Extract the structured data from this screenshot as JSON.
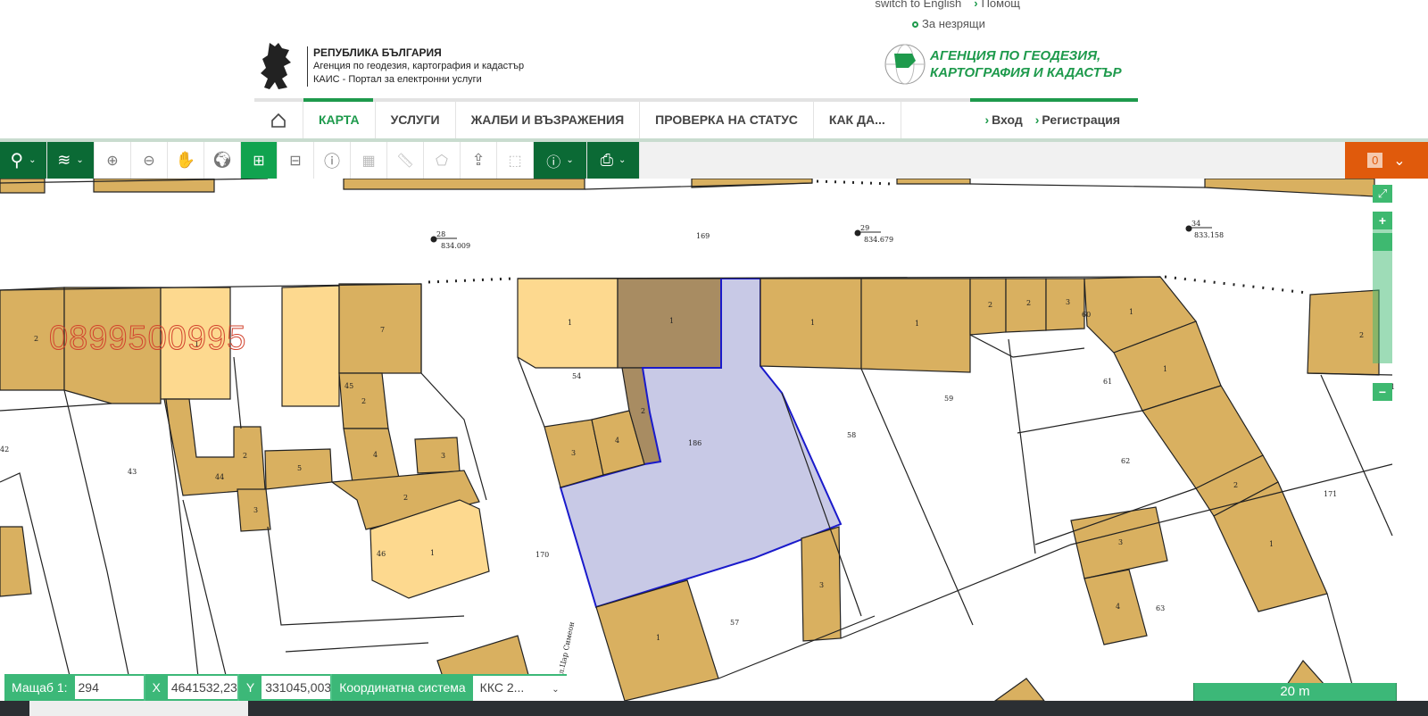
{
  "header": {
    "switch_language": "switch to English",
    "help": "Помощ",
    "blind": "За незрящи",
    "brand_line1": "РЕПУБЛИКА БЪЛГАРИЯ",
    "brand_line2": "Агенция по геодезия, картография и кадастър",
    "brand_line3": "КАИС - Портал за електронни услуги",
    "agency_line1": "АГЕНЦИЯ ПО ГЕОДЕЗИЯ,",
    "agency_line2": "КАРТОГРАФИЯ И КАДАСТЪР"
  },
  "nav": {
    "items": [
      {
        "label": "КАРТА",
        "active": true
      },
      {
        "label": "УСЛУГИ"
      },
      {
        "label": "ЖАЛБИ И ВЪЗРАЖЕНИЯ"
      },
      {
        "label": "ПРОВЕРКА НА СТАТУС"
      },
      {
        "label": "КАК ДА..."
      }
    ],
    "login": "Вход",
    "register": "Регистрация"
  },
  "toolbar": {
    "icons": [
      "search-icon",
      "layers-icon",
      "zoom-in-icon",
      "zoom-out-icon",
      "pan-hand-icon",
      "globe-icon",
      "select-add-icon",
      "select-remove-icon",
      "info-icon",
      "measure-area-icon",
      "ruler-icon",
      "polygon-icon",
      "upload-icon",
      "select-area-icon",
      "layer-info-icon",
      "print-icon"
    ],
    "active_tool": "select-add-icon",
    "cart_count": "0"
  },
  "map": {
    "watermark": "0899500995",
    "street": "ул.Цар Симеон",
    "parcels": [
      "169",
      "43",
      "44",
      "45",
      "46",
      "54",
      "186",
      "58",
      "59",
      "61",
      "62",
      "63",
      "170",
      "171",
      "57",
      "42",
      "11",
      "1",
      "2",
      "3",
      "4",
      "5",
      "7",
      "60"
    ],
    "points": [
      {
        "id": "28",
        "elev": "834.009"
      },
      {
        "id": "29",
        "elev": "834.679"
      },
      {
        "id": "34",
        "elev": "833.158"
      }
    ],
    "colors": {
      "building": "#d9b060",
      "light": "#fdd98f",
      "dark": "#a88c62",
      "selected": "#c8c9e6",
      "selected_border": "#1a1acb"
    }
  },
  "status": {
    "scale_label": "Мащаб  1:",
    "scale_value": "294",
    "x_label": "X",
    "x_value": "4641532,23",
    "y_label": "Y",
    "y_value": "331045,003",
    "crs_label": "Координатна система",
    "crs_value": "ККС 2...",
    "scalebar": "20 m"
  },
  "accent": "#1e9a4c"
}
